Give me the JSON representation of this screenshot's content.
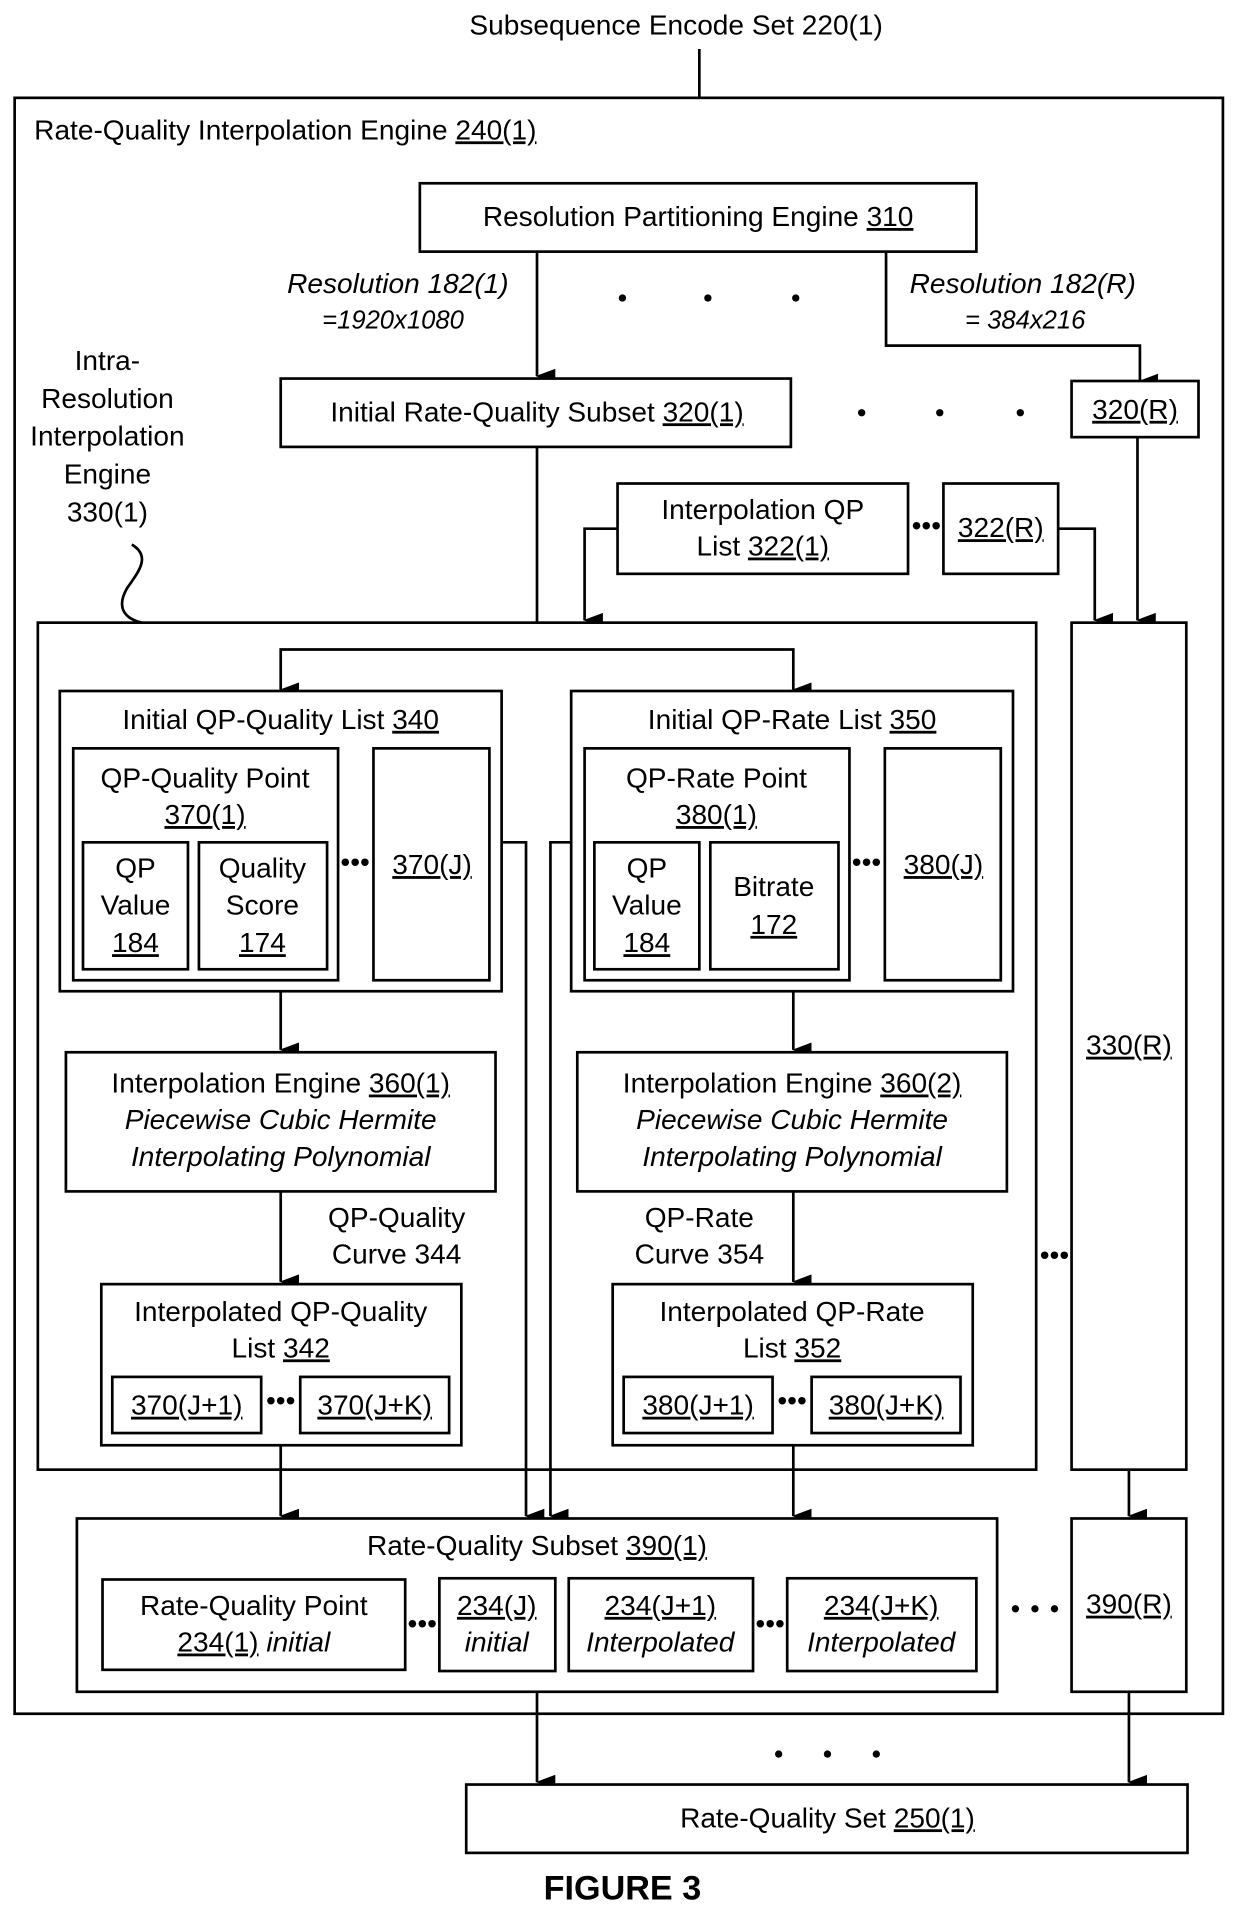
{
  "input": {
    "label": "Subsequence Encode Set 220(1)"
  },
  "engine": {
    "label": "Rate-Quality Interpolation Engine ",
    "ref": "240(1)"
  },
  "partitioner": {
    "label": "Resolution Partitioning Engine ",
    "ref": "310"
  },
  "resolution_first": {
    "label": "Resolution 182(1)",
    "value": "=1920x1080"
  },
  "resolution_last": {
    "label": "Resolution 182(R)",
    "value": "= 384x216"
  },
  "intra_label": {
    "lines": [
      "Intra-",
      "Resolution",
      "Interpolation",
      "Engine",
      "330(1)"
    ]
  },
  "initial_subset": {
    "label": "Initial Rate-Quality Subset ",
    "ref": "320(1)",
    "last_ref": "320(R)"
  },
  "qp_list": {
    "line1": "Interpolation QP",
    "line2": "List ",
    "ref": "322(1)",
    "last_ref": "322(R)"
  },
  "qp_quality_list": {
    "label": "Initial QP-Quality List ",
    "ref": "340",
    "point_label": "QP-Quality Point",
    "point_ref": "370(1)",
    "qp_line1": "QP",
    "qp_line2": "Value",
    "qp_ref": "184",
    "score_line1": "Quality",
    "score_line2": "Score",
    "score_ref": "174",
    "last_ref": "370(J)"
  },
  "qp_rate_list": {
    "label": "Initial QP-Rate List ",
    "ref": "350",
    "point_label": "QP-Rate Point",
    "point_ref": "380(1)",
    "qp_line1": "QP",
    "qp_line2": "Value",
    "qp_ref": "184",
    "bitrate_line1": "Bitrate",
    "bitrate_ref": "172",
    "last_ref": "380(J)"
  },
  "interp_engine_1": {
    "label": "Interpolation Engine ",
    "ref": "360(1)",
    "line2": "Piecewise Cubic Hermite",
    "line3": "Interpolating Polynomial"
  },
  "interp_engine_2": {
    "label": "Interpolation Engine ",
    "ref": "360(2)",
    "line2": "Piecewise Cubic Hermite",
    "line3": "Interpolating Polynomial"
  },
  "curve_quality": {
    "line1": "QP-Quality",
    "line2": "Curve 344"
  },
  "curve_rate": {
    "line1": "QP-Rate",
    "line2": "Curve 354"
  },
  "interp_quality_list": {
    "line1": "Interpolated QP-Quality",
    "line2": "List ",
    "ref": "342",
    "first": "370(J+1)",
    "last": "370(J+K)"
  },
  "interp_rate_list": {
    "line1": "Interpolated QP-Rate",
    "line2": "List ",
    "ref": "352",
    "first": "380(J+1)",
    "last": "380(J+K)"
  },
  "last_engine": {
    "ref": "330(R)"
  },
  "rq_subset": {
    "label": "Rate-Quality Subset ",
    "ref": "390(1)",
    "p1_line1": "Rate-Quality Point",
    "p1_ref": "234(1)",
    "p1_tag": " initial",
    "pj_ref": "234(J)",
    "pj_tag": "initial",
    "pj1_ref": "234(J+1)",
    "pj1_tag": "Interpolated",
    "pjk_ref": "234(J+K)",
    "pjk_tag": "Interpolated",
    "last_ref": "390(R)"
  },
  "output": {
    "label": "Rate-Quality Set ",
    "ref": "250(1)"
  },
  "figure": {
    "caption": "FIGURE 3"
  },
  "ellipsis": "•••"
}
